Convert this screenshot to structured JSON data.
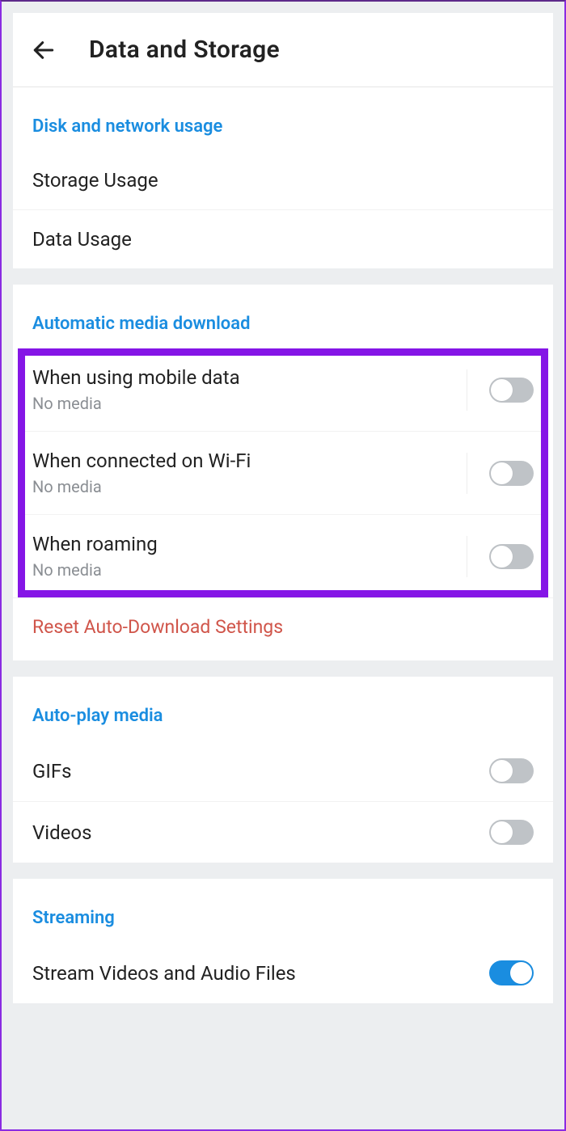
{
  "header": {
    "title": "Data and Storage"
  },
  "disk": {
    "heading": "Disk and network usage",
    "storage": "Storage Usage",
    "data": "Data Usage"
  },
  "auto": {
    "heading": "Automatic media download",
    "mobile": {
      "title": "When using mobile data",
      "sub": "No media"
    },
    "wifi": {
      "title": "When connected on Wi-Fi",
      "sub": "No media"
    },
    "roaming": {
      "title": "When roaming",
      "sub": "No media"
    },
    "reset": "Reset Auto-Download Settings"
  },
  "autoplay": {
    "heading": "Auto-play media",
    "gifs": "GIFs",
    "videos": "Videos"
  },
  "streaming": {
    "heading": "Streaming",
    "stream": "Stream Videos and Audio Files"
  }
}
